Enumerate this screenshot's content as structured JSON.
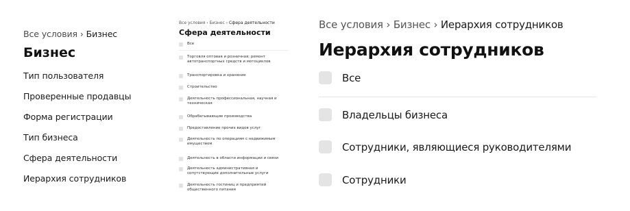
{
  "panel_business": {
    "breadcrumb": {
      "root": "Все условия",
      "sep": "›",
      "current": "Бизнес"
    },
    "title": "Бизнес",
    "menu": [
      "Тип пользователя",
      "Проверенные продавцы",
      "Форма регистрации",
      "Тип бизнеса",
      "Сфера деятельности",
      "Иерархия сотрудников"
    ]
  },
  "panel_activity": {
    "breadcrumb": {
      "root": "Все условия",
      "sep1": "›",
      "mid": "Бизнес",
      "sep2": "›",
      "current": "Сфера деятельности"
    },
    "title": "Сфера деятельности",
    "all_label": "Все",
    "options": [
      "Торговля оптовая и розничная; ремонт автотранспортных средств и мотоциклов",
      "Транспортировка и хранение",
      "Строительство",
      "Деятельность профессиональная, научная и техническая",
      "Обрабатывающие производства",
      "Предоставление прочих видов услуг",
      "Деятельность по операциям с недвижимым имуществом",
      "Деятельность в области информации и связи",
      "Деятельность административная и сопутствующие дополнительные услуги",
      "Деятельность гостиниц и предприятий общественного питания"
    ]
  },
  "panel_hierarchy": {
    "breadcrumb": {
      "root": "Все условия",
      "sep1": "›",
      "mid": "Бизнес",
      "sep2": "›",
      "current": "Иерархия сотрудников"
    },
    "title": "Иерархия сотрудников",
    "all_label": "Все",
    "options": [
      "Владельцы бизнеса",
      "Сотрудники, являющиеся руководителями",
      "Сотрудники"
    ]
  },
  "colors": {
    "checkbox": "#e4e4e4",
    "divider": "#e6e6e6",
    "text": "#1a1a1a",
    "muted": "#555555"
  }
}
